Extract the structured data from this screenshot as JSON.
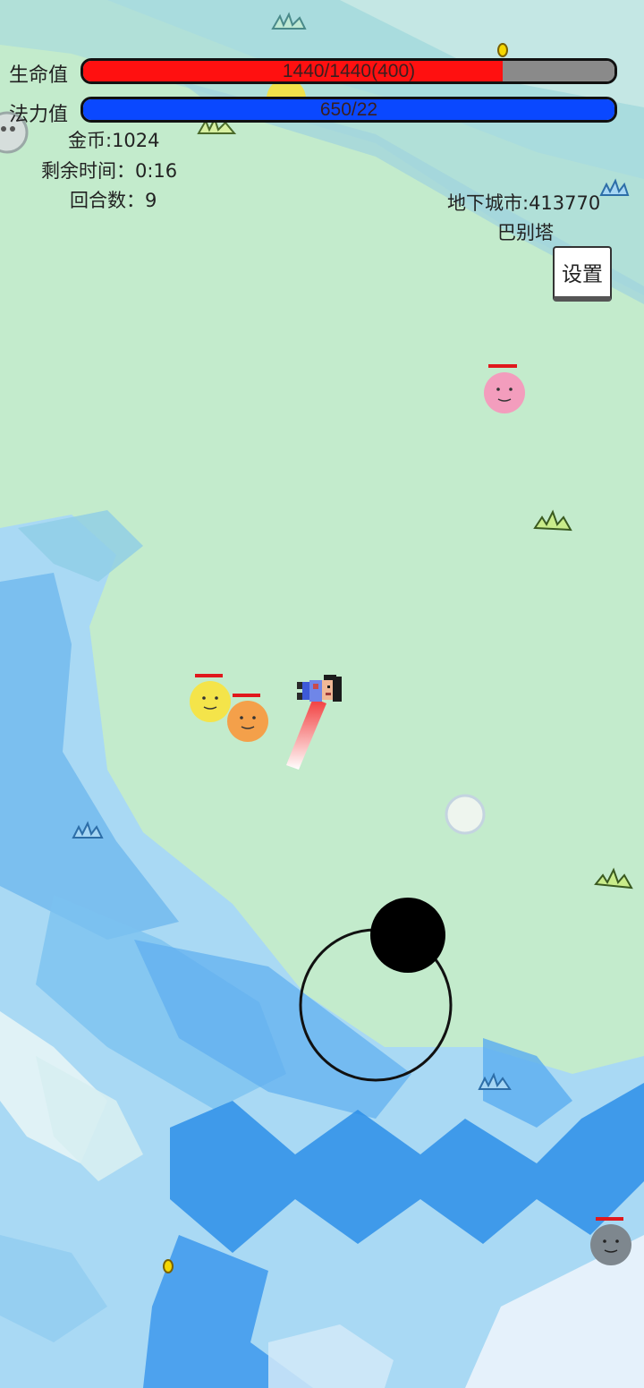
{
  "hud": {
    "hp_label": "生命值",
    "hp_text": "1440/1440(400)",
    "hp_fill_fraction": 0.79,
    "mp_label": "法力值",
    "mp_text": "650/22",
    "mp_fill_fraction": 1.0,
    "gold": "金币:1024",
    "time_left": "剩余时间：0:16",
    "round": "回合数：9",
    "dungeon_coins": "地下城市:413770",
    "location": "巴别塔",
    "settings_label": "设置"
  },
  "colors": {
    "ground": "#c3ebcc",
    "hp_fill": "#ff1010",
    "hp_empty": "#8a8a8a",
    "mp_fill": "#0a48ff",
    "water_light": "#a9d9f4",
    "water_mid": "#6fb8ee",
    "water_dark": "#2d8ee8"
  },
  "entities": {
    "player": "pixel-hero",
    "enemies": [
      "yellow-smiley",
      "orange-smiley",
      "pink-smiley",
      "gray-smiley"
    ],
    "pickups": [
      "gold-coin",
      "gold-coin"
    ],
    "decor": [
      "grass-tuft"
    ]
  },
  "joystick": {
    "name": "virtual-joystick"
  }
}
